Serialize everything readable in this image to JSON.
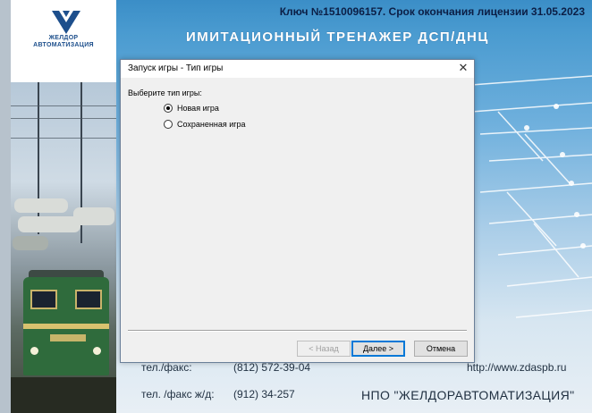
{
  "splash": {
    "license": "Ключ №1510096157. Срок окончания лицензии 31.05.2023",
    "title": "ИМИТАЦИОННЫЙ ТРЕНАЖЕР ДСП/ДНЦ",
    "logo_line1": "ЖЕЛДОР",
    "logo_line2": "АВТОМАТИЗАЦИЯ",
    "footer": {
      "label1": "тел./факс:",
      "phone1": "(812) 572-39-04",
      "url": "http://www.zdaspb.ru",
      "label2": "тел. /факс ж/д:",
      "phone2": "(912) 34-257",
      "company": "НПО \"ЖЕЛДОРАВТОМАТИЗАЦИЯ\""
    }
  },
  "dialog": {
    "title": "Запуск игры - Тип игры",
    "close_glyph": "✕",
    "prompt": "Выберите тип игры:",
    "options": [
      {
        "label": "Новая игра",
        "checked": true
      },
      {
        "label": "Сохраненная игра",
        "checked": false
      }
    ],
    "buttons": {
      "back": "< Назад",
      "next": "Далее >",
      "cancel": "Отмена"
    }
  },
  "colors": {
    "accent": "#0078d7",
    "title_text": "#ffffff",
    "license_text": "#0b1e45"
  }
}
